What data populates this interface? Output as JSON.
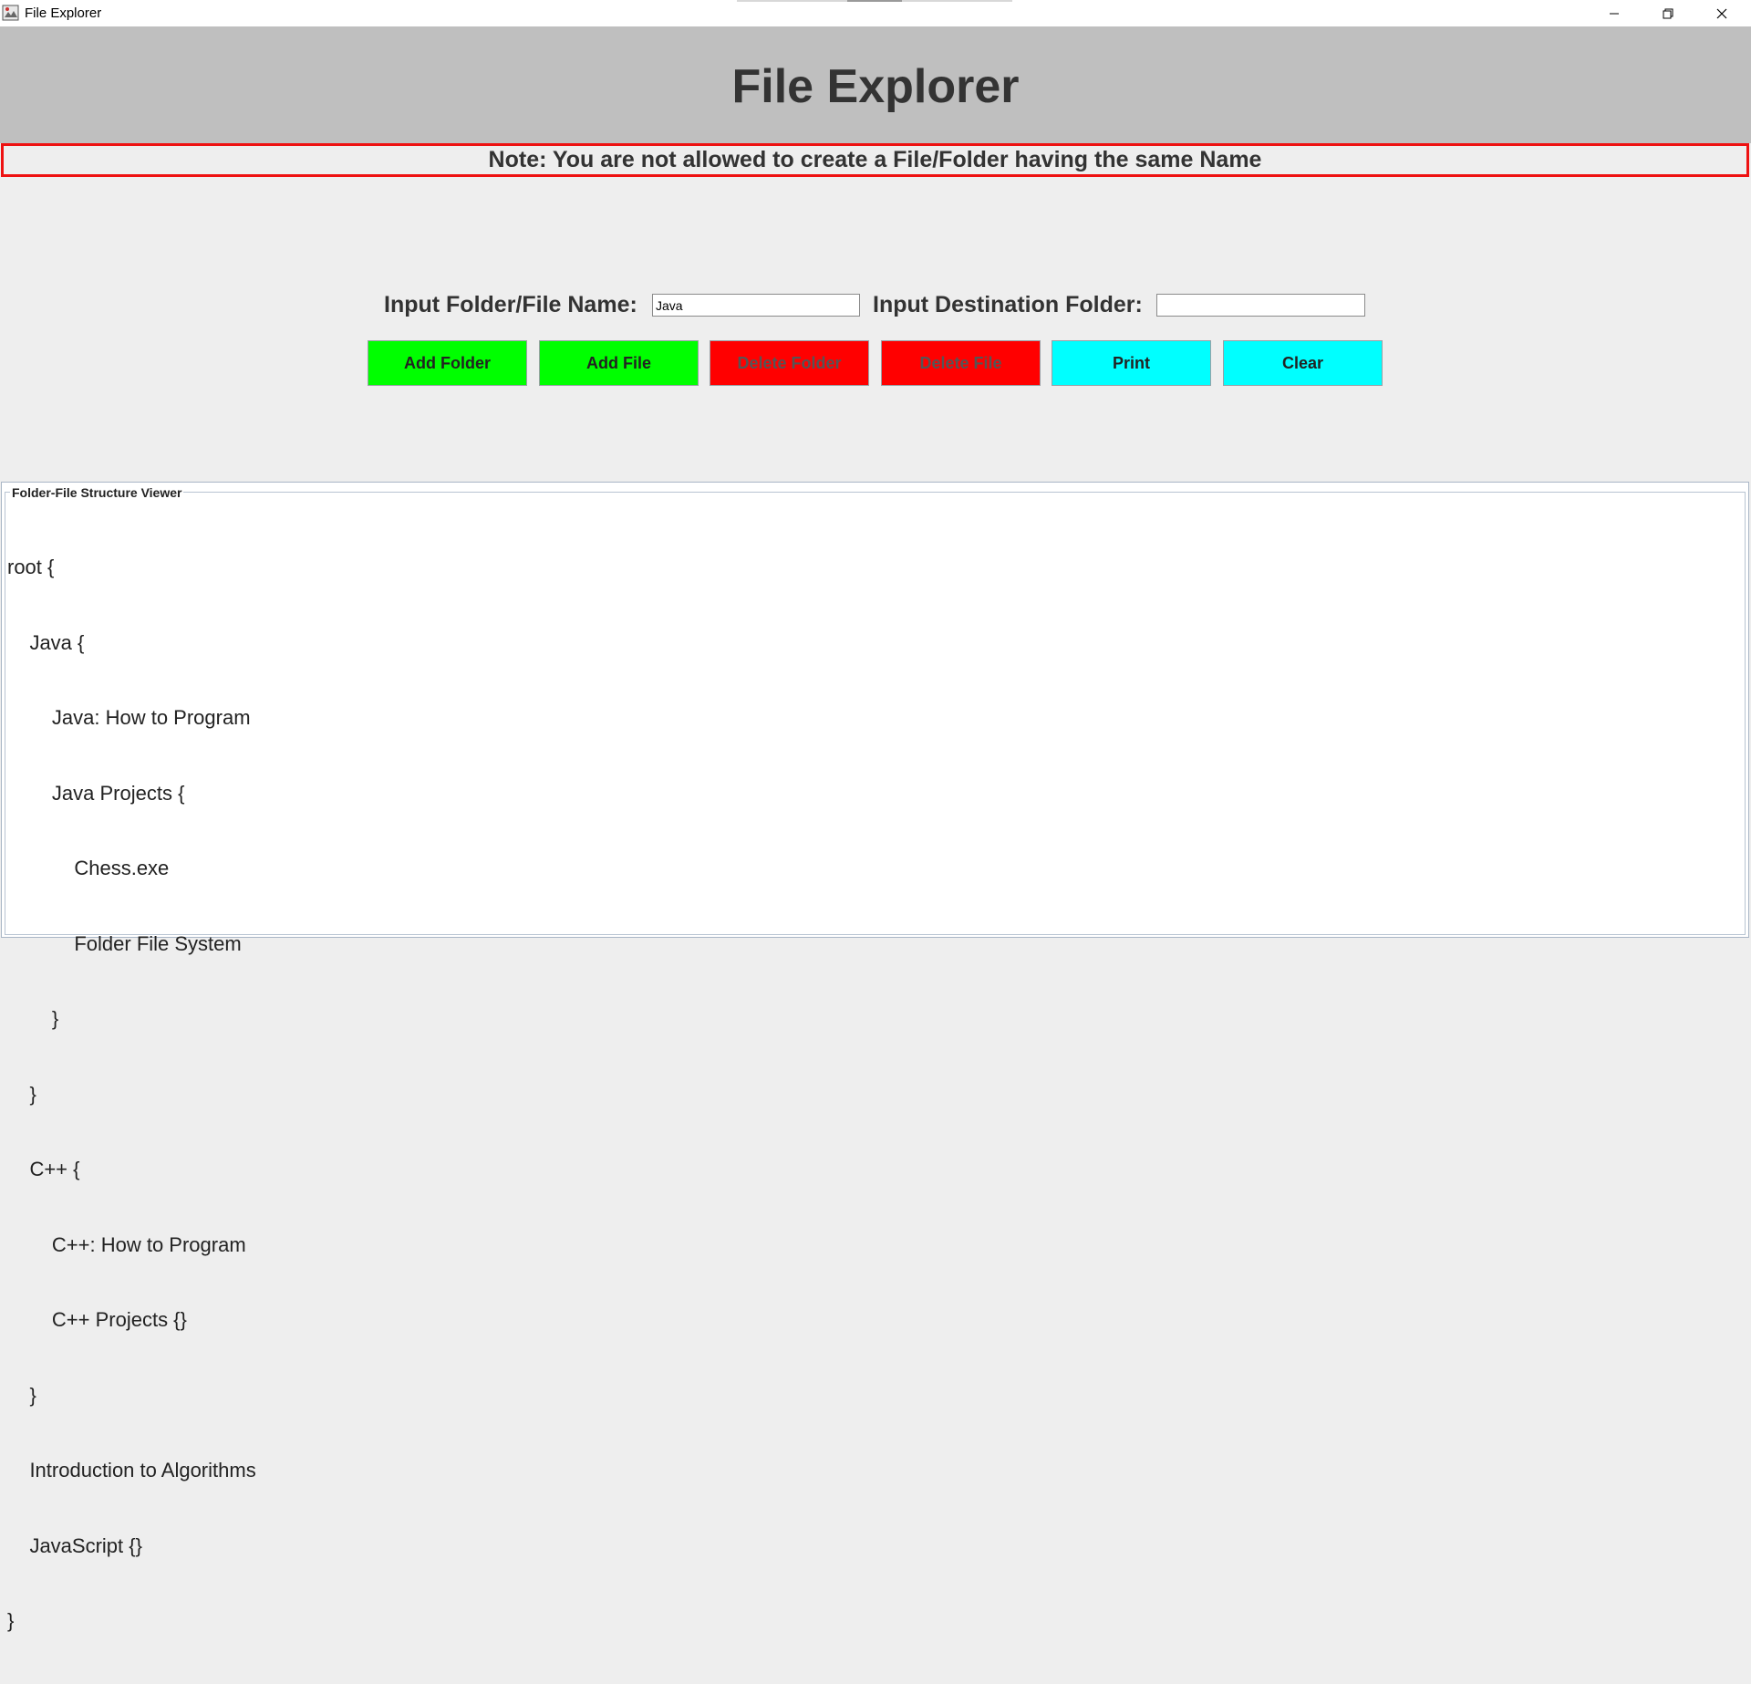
{
  "window": {
    "title": "File Explorer",
    "icons": [
      "app-icon",
      "minimize-icon",
      "maximize-icon",
      "close-icon"
    ]
  },
  "header": {
    "title": "File Explorer",
    "background": "#bfbfbf"
  },
  "note": {
    "text": "Note: You are not allowed to create a File/Folder having the same Name",
    "border_color": "#ee1111"
  },
  "form": {
    "name_label": "Input Folder/File Name:",
    "name_value": "Java",
    "dest_label": "Input Destination Folder:",
    "dest_value": ""
  },
  "buttons": {
    "add_folder": "Add Folder",
    "add_file": "Add File",
    "delete_folder": "Delete Folder",
    "delete_file": "Delete File",
    "print": "Print",
    "clear": "Clear",
    "colors": {
      "add": "#00ff00",
      "delete": "#ff0000",
      "action": "#00ffff"
    }
  },
  "viewer": {
    "title": "Folder-File Structure Viewer",
    "lines": [
      "root {",
      "    Java {",
      "        Java: How to Program",
      "        Java Projects {",
      "            Chess.exe",
      "            Folder File System",
      "        }",
      "    }",
      "    C++ {",
      "        C++: How to Program",
      "        C++ Projects {}",
      "    }",
      "    Introduction to Algorithms",
      "    JavaScript {}",
      "}"
    ]
  }
}
